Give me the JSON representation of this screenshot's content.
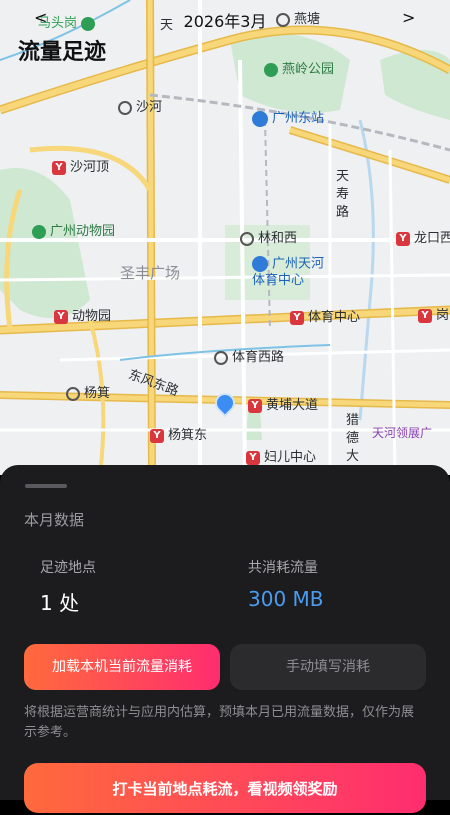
{
  "header": {
    "prev": "<",
    "next": ">",
    "month": "2026年3月",
    "title": "流量足迹"
  },
  "map": {
    "labels": {
      "matougang": "马头岗",
      "tianhe_top": "天",
      "yantang": "燕塘",
      "yanling_park": "燕岭公园",
      "shahe": "沙河",
      "guangzhou_east": "广州东站",
      "shaheding": "沙河顶",
      "tianshou_road": "天寿路",
      "zoo": "广州动物园",
      "linhexi": "林和西",
      "longkou": "龙口西",
      "shengfeng": "圣丰广场",
      "tianhe_sports": "广州天河体育中心",
      "dongwuyuan": "动物园",
      "tiyuzhongxin": "体育中心",
      "gang": "岗",
      "tiyuxilu": "体育西路",
      "dongfeng": "东风东路",
      "yangji": "杨箕",
      "huangpu": "黄埔大道",
      "liede": "猎德大",
      "yangjidong": "杨箕东",
      "tianhe_lingzhan": "天河领展广",
      "funv": "妇儿中心"
    },
    "colors": {
      "road": "#f7d779",
      "road_edge": "#e6b94a",
      "green": "#cfe8d2",
      "water": "#b8d8f0",
      "metro": "#d9363e",
      "pin": "#3b8df3"
    }
  },
  "sheet": {
    "section_title": "本月数据",
    "places_label": "足迹地点",
    "places_value": "1 处",
    "traffic_label": "共消耗流量",
    "traffic_value": "300 MB",
    "btn_load": "加载本机当前流量消耗",
    "btn_manual": "手动填写消耗",
    "note": "将根据运营商统计与应用内估算，预填本月已用流量数据，仅作为展示参考。",
    "btn_checkin": "打卡当前地点耗流，看视频领奖励",
    "value_color": "#4a9cf0"
  }
}
